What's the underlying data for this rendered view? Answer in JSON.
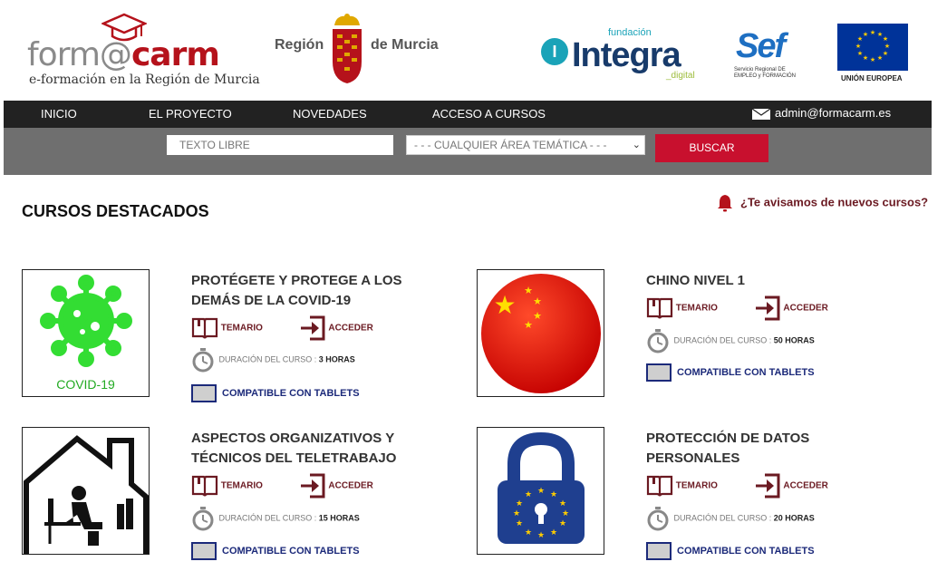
{
  "header": {
    "formacarm": {
      "brand_a": "form@",
      "brand_b": "carm",
      "tagline": "e-formación en la Región de Murcia"
    },
    "region": {
      "left": "Región",
      "right": "de Murcia"
    },
    "integra": {
      "fundacion": "fundación",
      "name": "Integra",
      "digital": "_digital"
    },
    "sef": {
      "name": "Sef",
      "sub": "Servicio Regional DE EMPLEO y FORMACIÓN"
    },
    "eu": {
      "label": "UNIÓN EUROPEA"
    }
  },
  "nav": {
    "items": [
      {
        "label": "INICIO"
      },
      {
        "label": "EL PROYECTO"
      },
      {
        "label": "NOVEDADES"
      },
      {
        "label": "ACCESO A CURSOS"
      }
    ],
    "email": "admin@formacarm.es"
  },
  "search": {
    "placeholder": "TEXTO LIBRE",
    "area_selected": "- - - CUALQUIER ÁREA TEMÁTICA - - -",
    "button": "BUSCAR"
  },
  "section": {
    "title": "CURSOS DESTACADOS",
    "notify": "¿Te avisamos de nuevos cursos?"
  },
  "labels": {
    "temario": "TEMARIO",
    "acceder": "ACCEDER",
    "duracion": "DURACIÓN DEL CURSO :",
    "compatible": "COMPATIBLE CON TABLETS"
  },
  "courses": [
    {
      "title": "PROTÉGETE Y PROTEGE A LOS DEMÁS DE LA COVID-19",
      "duration": "3 HORAS",
      "thumb_label": "COVID-19"
    },
    {
      "title": "CHINO NIVEL 1",
      "duration": "50 HORAS"
    },
    {
      "title": "ASPECTOS ORGANIZATIVOS Y TÉCNICOS DEL TELETRABAJO",
      "duration": "15 HORAS"
    },
    {
      "title": "PROTECCIÓN DE DATOS PERSONALES",
      "duration": "20 HORAS"
    }
  ],
  "colors": {
    "accent": "#c8102e",
    "nav_bg": "#222222",
    "search_bg": "#6f6f6f",
    "link_dark_red": "#6b1a22",
    "tablet_blue": "#1c2a7a"
  }
}
